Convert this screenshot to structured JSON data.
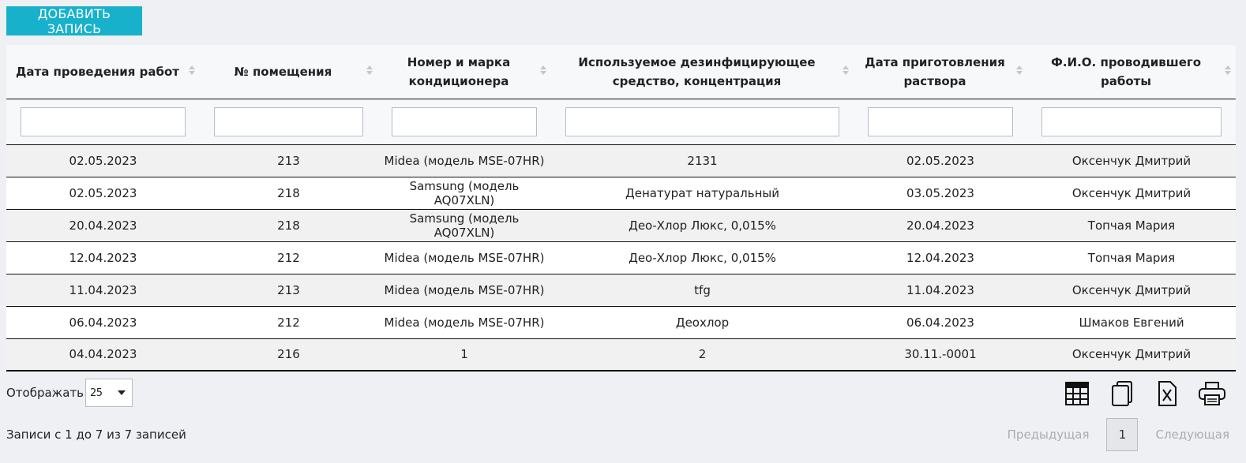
{
  "toolbar": {
    "add_label": "ДОБАВИТЬ ЗАПИСЬ"
  },
  "table": {
    "columns": [
      "Дата проведения работ",
      "№ помещения",
      "Номер и марка кондиционера",
      "Используемое дезинфицирующее средство, концентрация",
      "Дата приготовления раствора",
      "Ф.И.О. проводившего работы"
    ],
    "filters": [
      "",
      "",
      "",
      "",
      "",
      ""
    ],
    "rows": [
      [
        "02.05.2023",
        "213",
        "Midea (модель MSE-07HR)",
        "2131",
        "02.05.2023",
        "Оксенчук Дмитрий"
      ],
      [
        "02.05.2023",
        "218",
        "Samsung (модель AQ07XLN)",
        "Денатурат натуральный",
        "03.05.2023",
        "Оксенчук Дмитрий"
      ],
      [
        "20.04.2023",
        "218",
        "Samsung (модель AQ07XLN)",
        "Део-Хлор Люкс, 0,015%",
        "20.04.2023",
        "Топчая Мария"
      ],
      [
        "12.04.2023",
        "212",
        "Midea (модель MSE-07HR)",
        "Део-Хлор Люкс, 0,015%",
        "12.04.2023",
        "Топчая Мария"
      ],
      [
        "11.04.2023",
        "213",
        "Midea (модель MSE-07HR)",
        "tfg",
        "11.04.2023",
        "Оксенчук Дмитрий"
      ],
      [
        "06.04.2023",
        "212",
        "Midea (модель MSE-07HR)",
        "Деохлор",
        "06.04.2023",
        "Шмаков Евгений"
      ],
      [
        "04.04.2023",
        "216",
        "1",
        "2",
        "30.11.-0001",
        "Оксенчук Дмитрий"
      ]
    ]
  },
  "length": {
    "label": "Отображать",
    "value": "25"
  },
  "export_tools": [
    "table-icon",
    "copy-icon",
    "excel-icon",
    "print-icon"
  ],
  "info": "Записи с 1 до 7 из 7 записей",
  "pager": {
    "prev": "Предыдущая",
    "page": "1",
    "next": "Следующая"
  },
  "colors": {
    "accent": "#17b1cc",
    "background": "#eef0f3"
  }
}
